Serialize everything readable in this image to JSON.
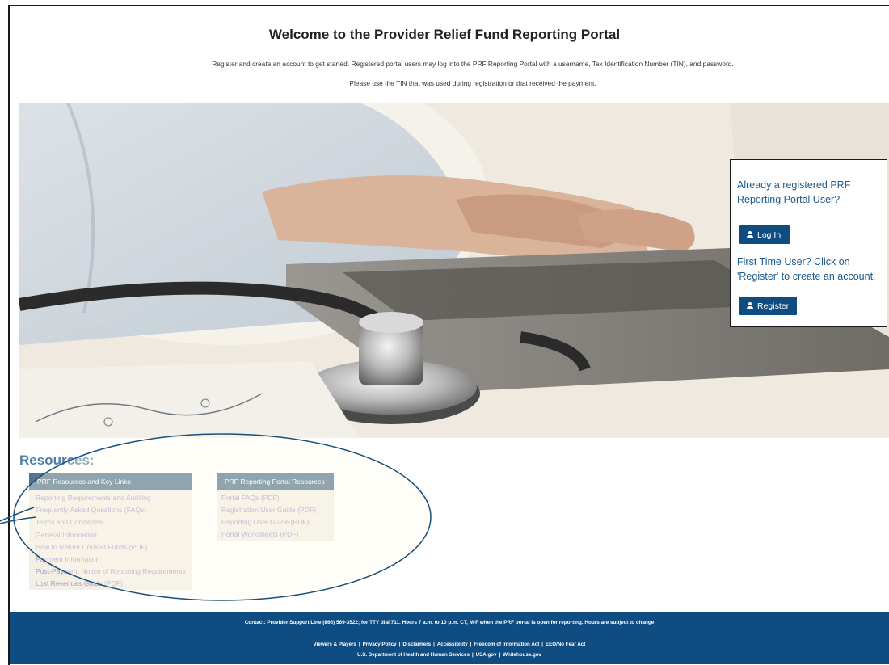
{
  "header": {
    "title": "Welcome to the Provider Relief Fund Reporting Portal",
    "intro_line1": "Register and create an account to get started. Registered portal users may log into the PRF Reporting Portal with a username, Tax Identification Number (TIN), and password.",
    "intro_line2": "Please use the TIN that was used during registration or that received the payment."
  },
  "login": {
    "registered_question": "Already a registered PRF Reporting Portal User?",
    "login_label": "Log In",
    "first_time_text": "First Time User? Click on 'Register' to create an account.",
    "register_label": "Register"
  },
  "resources": {
    "title": "Resources:",
    "key_links": {
      "heading": "PRF Resources and Key Links",
      "items": [
        "Reporting Requirements and Auditing",
        "Frequently Asked Questions (FAQs)",
        "Terms and Conditions",
        "General Information",
        "How to Return Unused Funds (PDF)",
        "Payment Information",
        "Post-Payment Notice of Reporting Requirements",
        "Lost Revenues Guide (PDF)"
      ]
    },
    "portal_resources": {
      "heading": "PRF Reporting Portal Resources",
      "items": [
        "Portal FAQs (PDF)",
        "Registration User Guide (PDF)",
        "Reporting User Guide (PDF)",
        "Portal Worksheets (PDF)"
      ]
    }
  },
  "footer": {
    "contact": "Contact: Provider Support Line (866) 569-3522; for TTY dial 711. Hours 7 a.m. to 10 p.m. CT, M-F when the PRF portal is open for reporting. Hours are subject to change",
    "links_row1": [
      "Viewers & Players",
      "Privacy Policy",
      "Disclaimers",
      "Accessibility",
      "Freedom of Information Act",
      "EEO/No Fear Act"
    ],
    "links_row2": [
      "U.S. Department of Health and Human Services",
      "USA.gov",
      "Whitehouse.gov"
    ]
  },
  "colors": {
    "brand_blue": "#0f4c81",
    "question_text": "#1d5a8c",
    "resources_title": "#4d7ea8",
    "panel_header": "#55758f",
    "panel_bg": "#f4efe4",
    "link_text": "#a79ad0",
    "annotation": "#1a4f7a"
  },
  "icons": {
    "login_icon": "person-icon",
    "register_icon": "person-icon"
  }
}
